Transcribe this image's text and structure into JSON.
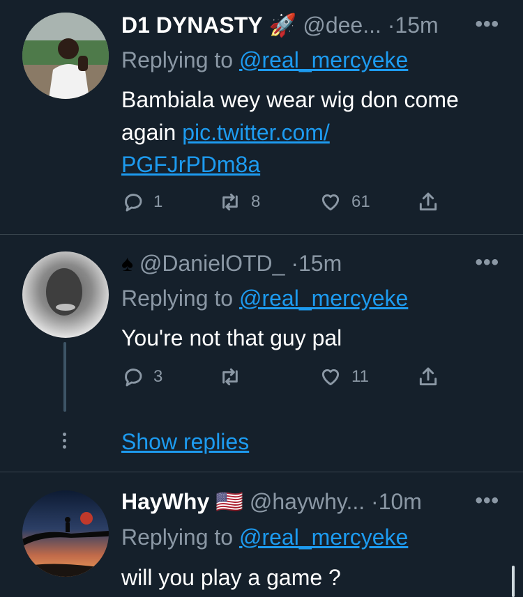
{
  "tweets": [
    {
      "name": "D1 DYNASTY",
      "emoji": "🚀",
      "handle": "@dee...",
      "time": "·15m",
      "reply_prefix": "Replying to",
      "reply_handle": "@real_mercyeke",
      "text_line1": "Bambiala wey wear wig don come",
      "text_line2": "again",
      "link_part1": "pic.twitter.com/",
      "link_part2": "PGFJrPDm8a",
      "counts": {
        "replies": "1",
        "retweets": "8",
        "likes": "61"
      }
    },
    {
      "name": "",
      "emoji": "♠",
      "handle": "@DanielOTD_",
      "time": "·15m",
      "reply_prefix": "Replying to",
      "reply_handle": "@real_mercyeke",
      "text_line1": "You're not that guy pal",
      "counts": {
        "replies": "3",
        "retweets": "",
        "likes": "11"
      },
      "show_replies": "Show replies"
    },
    {
      "name": "HayWhy",
      "emoji": "🇺🇸",
      "handle": "@haywhy...",
      "time": "·10m",
      "reply_prefix": "Replying to",
      "reply_handle": "@real_mercyeke",
      "text_line1": "will you play a game ?"
    }
  ],
  "more_label": "•••",
  "colors": {
    "background": "#15202b",
    "link": "#1d9bf0",
    "muted": "#8b98a5",
    "divider": "#38444d"
  },
  "icons": [
    "reply-icon",
    "retweet-icon",
    "like-icon",
    "share-icon",
    "more-icon"
  ]
}
